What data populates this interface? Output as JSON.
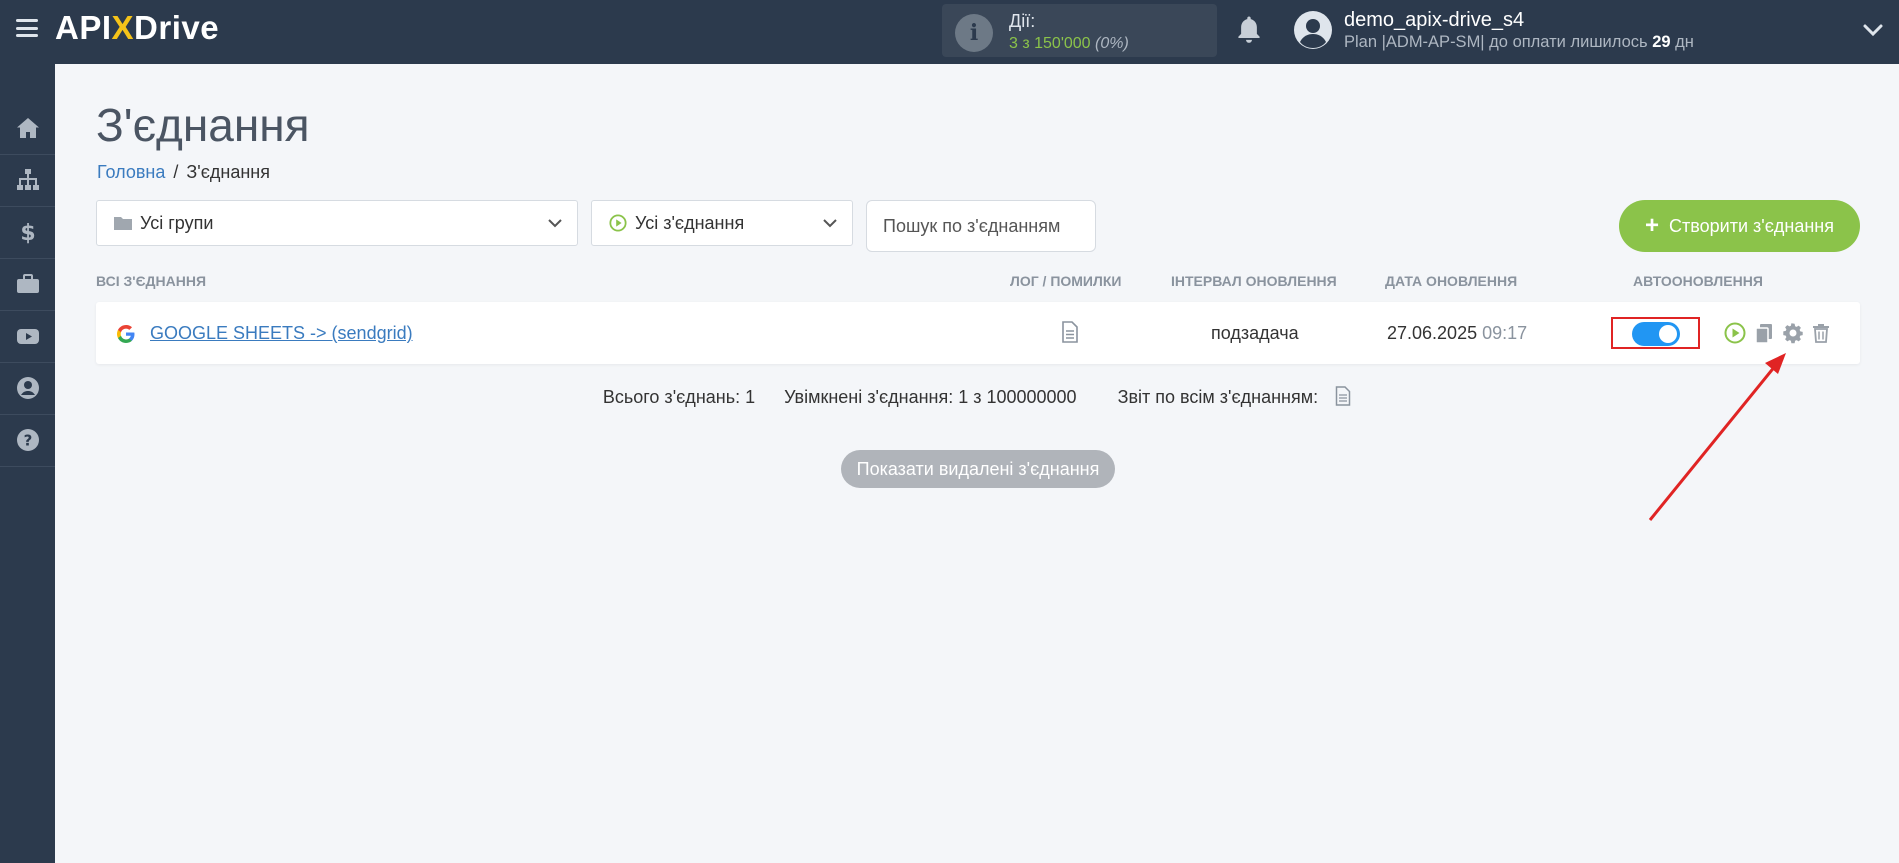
{
  "app": {
    "logo": {
      "part1": "API",
      "part2": "X",
      "part3": "Drive"
    },
    "actions": {
      "label": "Дії:",
      "value": "3 з 150'000",
      "percent": "(0%)"
    },
    "user": {
      "name": "demo_apix-drive_s4",
      "plan_prefix": "Plan |ADM-AP-SM| до оплати лишилось ",
      "days": "29",
      "days_suffix": " дн"
    }
  },
  "sidebar": {
    "items": [
      "home-icon",
      "sitemap-icon",
      "dollar-icon",
      "briefcase-icon",
      "youtube-icon",
      "user-icon",
      "help-icon"
    ]
  },
  "page": {
    "title": "З'єднання",
    "breadcrumb": {
      "home": "Головна",
      "separator": "/",
      "current": "З'єднання"
    }
  },
  "filters": {
    "groups": "Усі групи",
    "status": "Усі з'єднання",
    "search_placeholder": "Пошук по з'єднанням",
    "create_button": "Створити з'єднання"
  },
  "table": {
    "headers": {
      "all": "ВСІ З'ЄДНАННЯ",
      "log": "ЛОГ / ПОМИЛКИ",
      "interval": "ІНТЕРВАЛ ОНОВЛЕННЯ",
      "date": "ДАТА ОНОВЛЕННЯ",
      "auto": "АВТООНОВЛЕННЯ"
    },
    "rows": [
      {
        "name": "GOOGLE SHEETS -> (sendgrid)",
        "interval": "подзадача",
        "date": "27.06.2025",
        "time": "09:17",
        "auto_update": true
      }
    ]
  },
  "summary": {
    "total": "Всього з'єднань: 1",
    "enabled": "Увімкнені з'єднання: 1 з 100000000",
    "report": "Звіт по всім з'єднанням:"
  },
  "show_deleted": "Показати видалені з'єднання",
  "colors": {
    "topbar": "#2c3a4d",
    "accent_green": "#8bc34a",
    "link_blue": "#3a7bbf",
    "toggle_on": "#2196f3",
    "highlight_red": "#e02424"
  }
}
